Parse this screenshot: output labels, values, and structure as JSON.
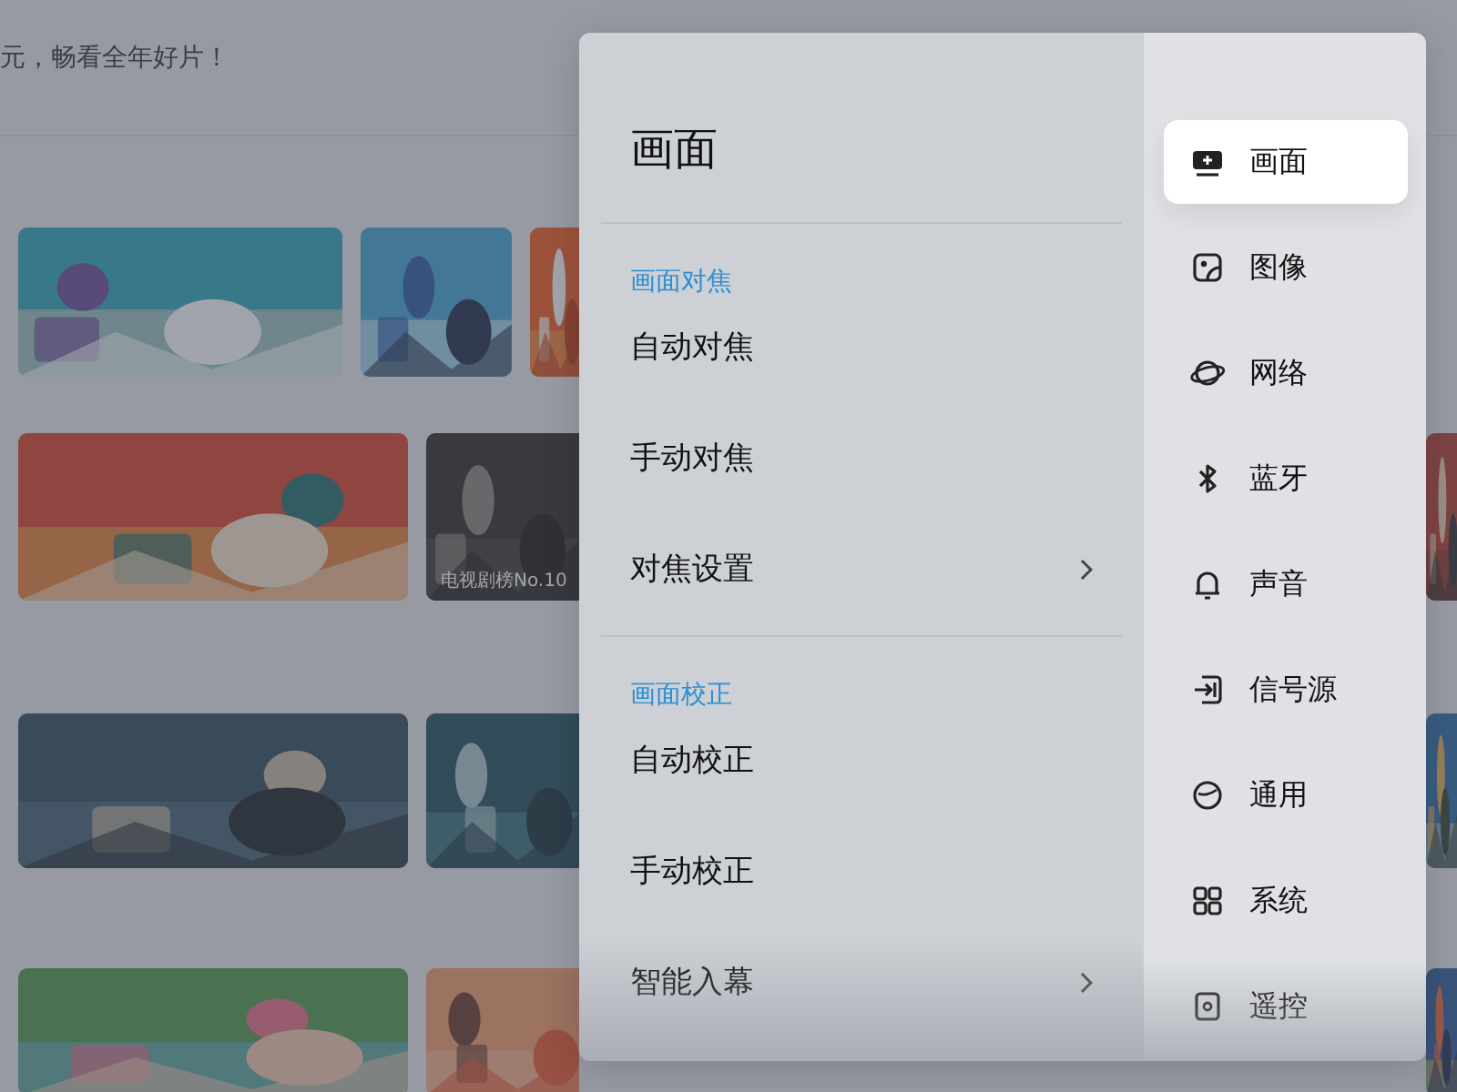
{
  "home": {
    "banner_text": "元，畅看全年好片！",
    "rows": [
      {
        "kind": "tiles",
        "cards": [
          {
            "kind": "picture"
          },
          {
            "kind": "picture"
          },
          {
            "kind": "picture"
          }
        ]
      },
      {
        "kind": "posters",
        "cards": [
          {
            "kind": "picture"
          },
          {
            "kind": "picture",
            "caption": "电视剧榜No.10"
          },
          {
            "kind": "picture"
          }
        ]
      },
      {
        "kind": "posters",
        "cards": [
          {
            "kind": "picture"
          },
          {
            "kind": "picture"
          },
          {
            "kind": "picture"
          }
        ]
      },
      {
        "kind": "posters",
        "cards": [
          {
            "kind": "picture"
          },
          {
            "kind": "picture"
          },
          {
            "kind": "picture"
          }
        ]
      }
    ]
  },
  "settings": {
    "title": "画面",
    "sections": [
      {
        "heading": "画面对焦",
        "items": [
          {
            "label": "自动对焦",
            "kind": "action"
          },
          {
            "label": "手动对焦",
            "kind": "action"
          },
          {
            "label": "对焦设置",
            "kind": "submenu"
          }
        ]
      },
      {
        "heading": "画面校正",
        "items": [
          {
            "label": "自动校正",
            "kind": "action"
          },
          {
            "label": "手动校正",
            "kind": "action"
          },
          {
            "label": "智能入幕",
            "kind": "submenu"
          }
        ]
      }
    ],
    "nav": [
      {
        "label": "画面",
        "selected": true
      },
      {
        "label": "图像",
        "selected": false
      },
      {
        "label": "网络",
        "selected": false
      },
      {
        "label": "蓝牙",
        "selected": false
      },
      {
        "label": "声音",
        "selected": false
      },
      {
        "label": "信号源",
        "selected": false
      },
      {
        "label": "通用",
        "selected": false
      },
      {
        "label": "系统",
        "selected": false
      },
      {
        "label": "遥控",
        "selected": false
      }
    ]
  }
}
